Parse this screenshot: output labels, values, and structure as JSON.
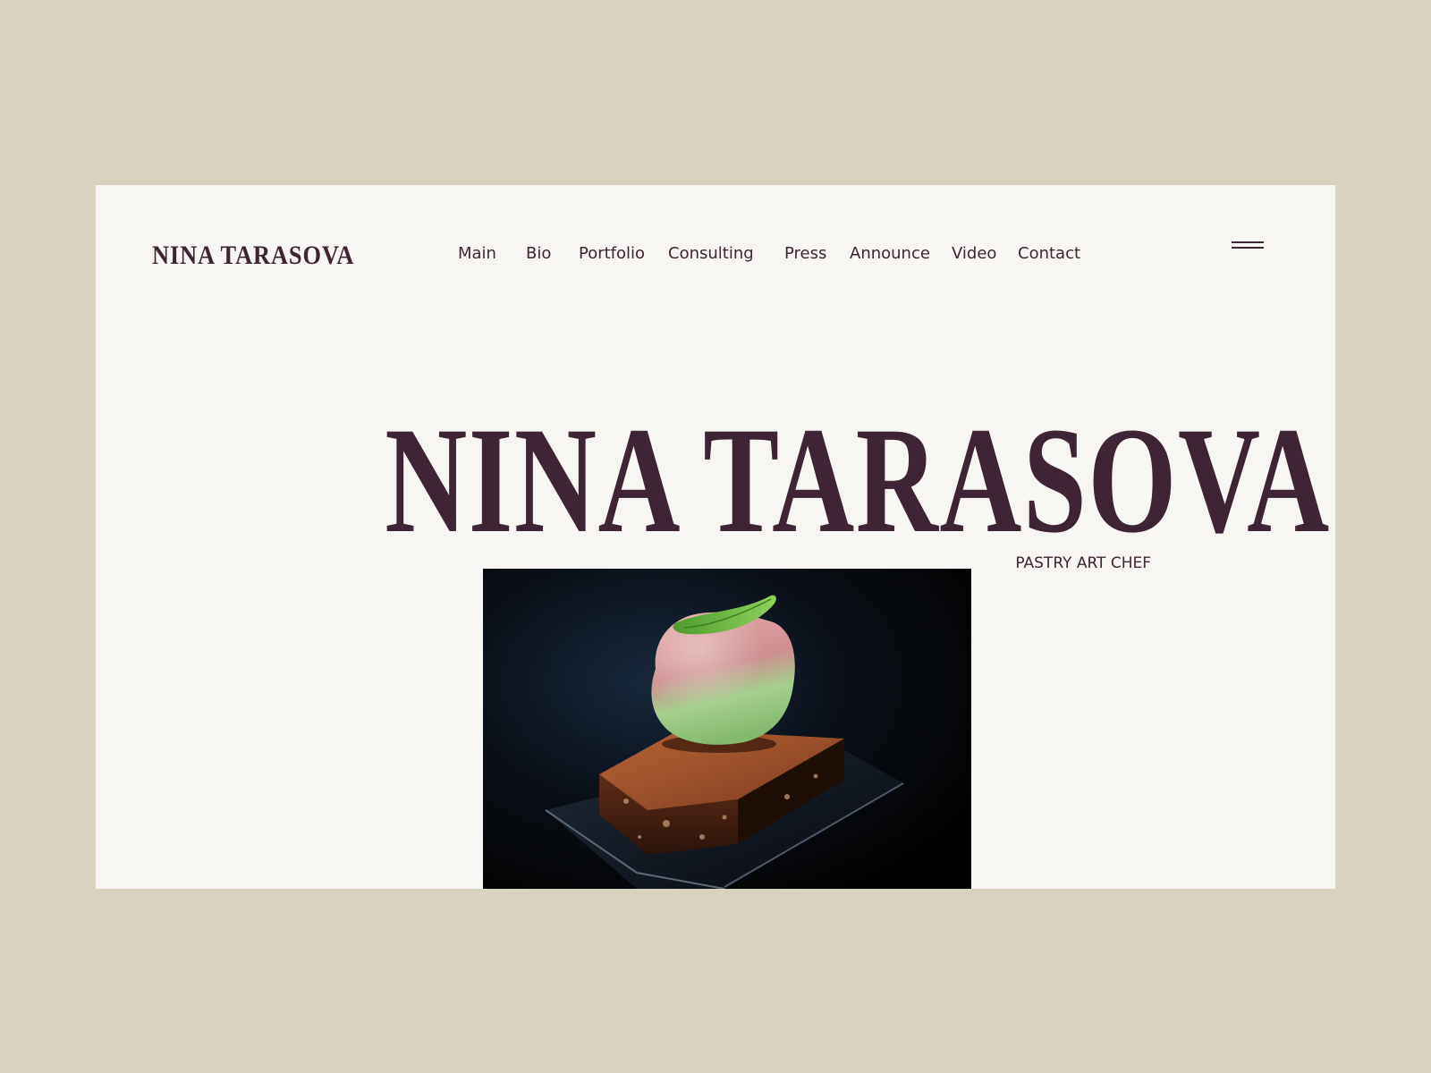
{
  "brand": {
    "logo_text": "NINA TARASOVA"
  },
  "nav": {
    "items": [
      {
        "id": "main",
        "label": "Main"
      },
      {
        "id": "bio",
        "label": "Bio"
      },
      {
        "id": "portfolio",
        "label": "Portfolio"
      },
      {
        "id": "consulting",
        "label": "Consulting"
      },
      {
        "id": "press",
        "label": "Press"
      },
      {
        "id": "announce",
        "label": "Announce"
      },
      {
        "id": "video",
        "label": "Video"
      },
      {
        "id": "contact",
        "label": "Contact"
      }
    ]
  },
  "menu": {
    "icon": "hamburger-menu-icon"
  },
  "hero": {
    "title": "NINA TARASOVA",
    "subtitle": "PASTRY ART CHEF",
    "image_subject": "dessert-photo"
  },
  "colors": {
    "page_background": "#d9d2bf",
    "site_background": "#f7f6f2",
    "text_accent": "#3e2434"
  }
}
